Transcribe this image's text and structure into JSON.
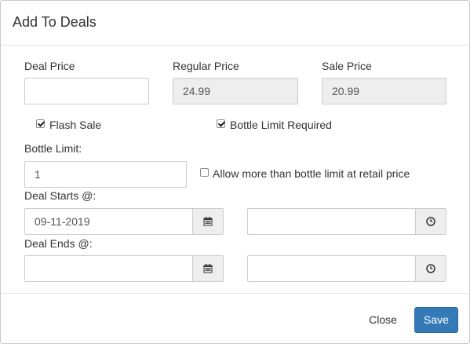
{
  "modal": {
    "title": "Add To Deals",
    "deal_price": {
      "label": "Deal Price",
      "value": ""
    },
    "regular_price": {
      "label": "Regular Price",
      "value": "24.99"
    },
    "sale_price": {
      "label": "Sale Price",
      "value": "20.99"
    },
    "flash_sale": {
      "label": "Flash Sale",
      "checked": true
    },
    "bottle_limit_required": {
      "label": "Bottle Limit Required",
      "checked": true
    },
    "bottle_limit": {
      "label": "Bottle Limit:",
      "value": "1"
    },
    "allow_more": {
      "label": "Allow more than bottle limit at retail price",
      "checked": false
    },
    "deal_starts": {
      "label": "Deal Starts @:",
      "date": "09-11-2019",
      "time": ""
    },
    "deal_ends": {
      "label": "Deal Ends @:",
      "date": "",
      "time": ""
    },
    "buttons": {
      "close": "Close",
      "save": "Save"
    }
  },
  "colors": {
    "primary": "#337ab7",
    "readonly_bg": "#eeeeee"
  },
  "icons": {
    "date": "calendar-icon",
    "time": "clock-icon",
    "checkbox": "check-icon"
  }
}
